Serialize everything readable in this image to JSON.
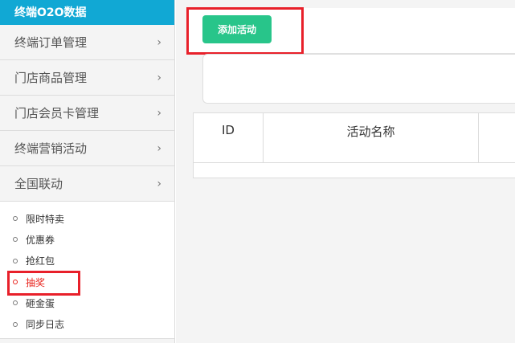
{
  "sidebar": {
    "header": "终端O2O数据",
    "menu": [
      {
        "label": "终端订单管理",
        "chevron": "›"
      },
      {
        "label": "门店商品管理",
        "chevron": "›"
      },
      {
        "label": "门店会员卡管理",
        "chevron": "›"
      },
      {
        "label": "终端营销活动",
        "chevron": "›"
      },
      {
        "label": "全国联动",
        "chevron": "›"
      }
    ],
    "submenu": [
      {
        "label": "限时特卖"
      },
      {
        "label": "优惠券"
      },
      {
        "label": "抢红包"
      },
      {
        "label": "抽奖"
      },
      {
        "label": "砸金蛋"
      },
      {
        "label": "同步日志"
      }
    ],
    "active_submenu": "抽奖"
  },
  "toolbar": {
    "add_label": "添加活动"
  },
  "table": {
    "headers": [
      "ID",
      "活动名称",
      ""
    ]
  },
  "colors": {
    "header_blue": "#11a8d4",
    "button_green": "#28c58a",
    "highlight_red": "#e8202a"
  }
}
